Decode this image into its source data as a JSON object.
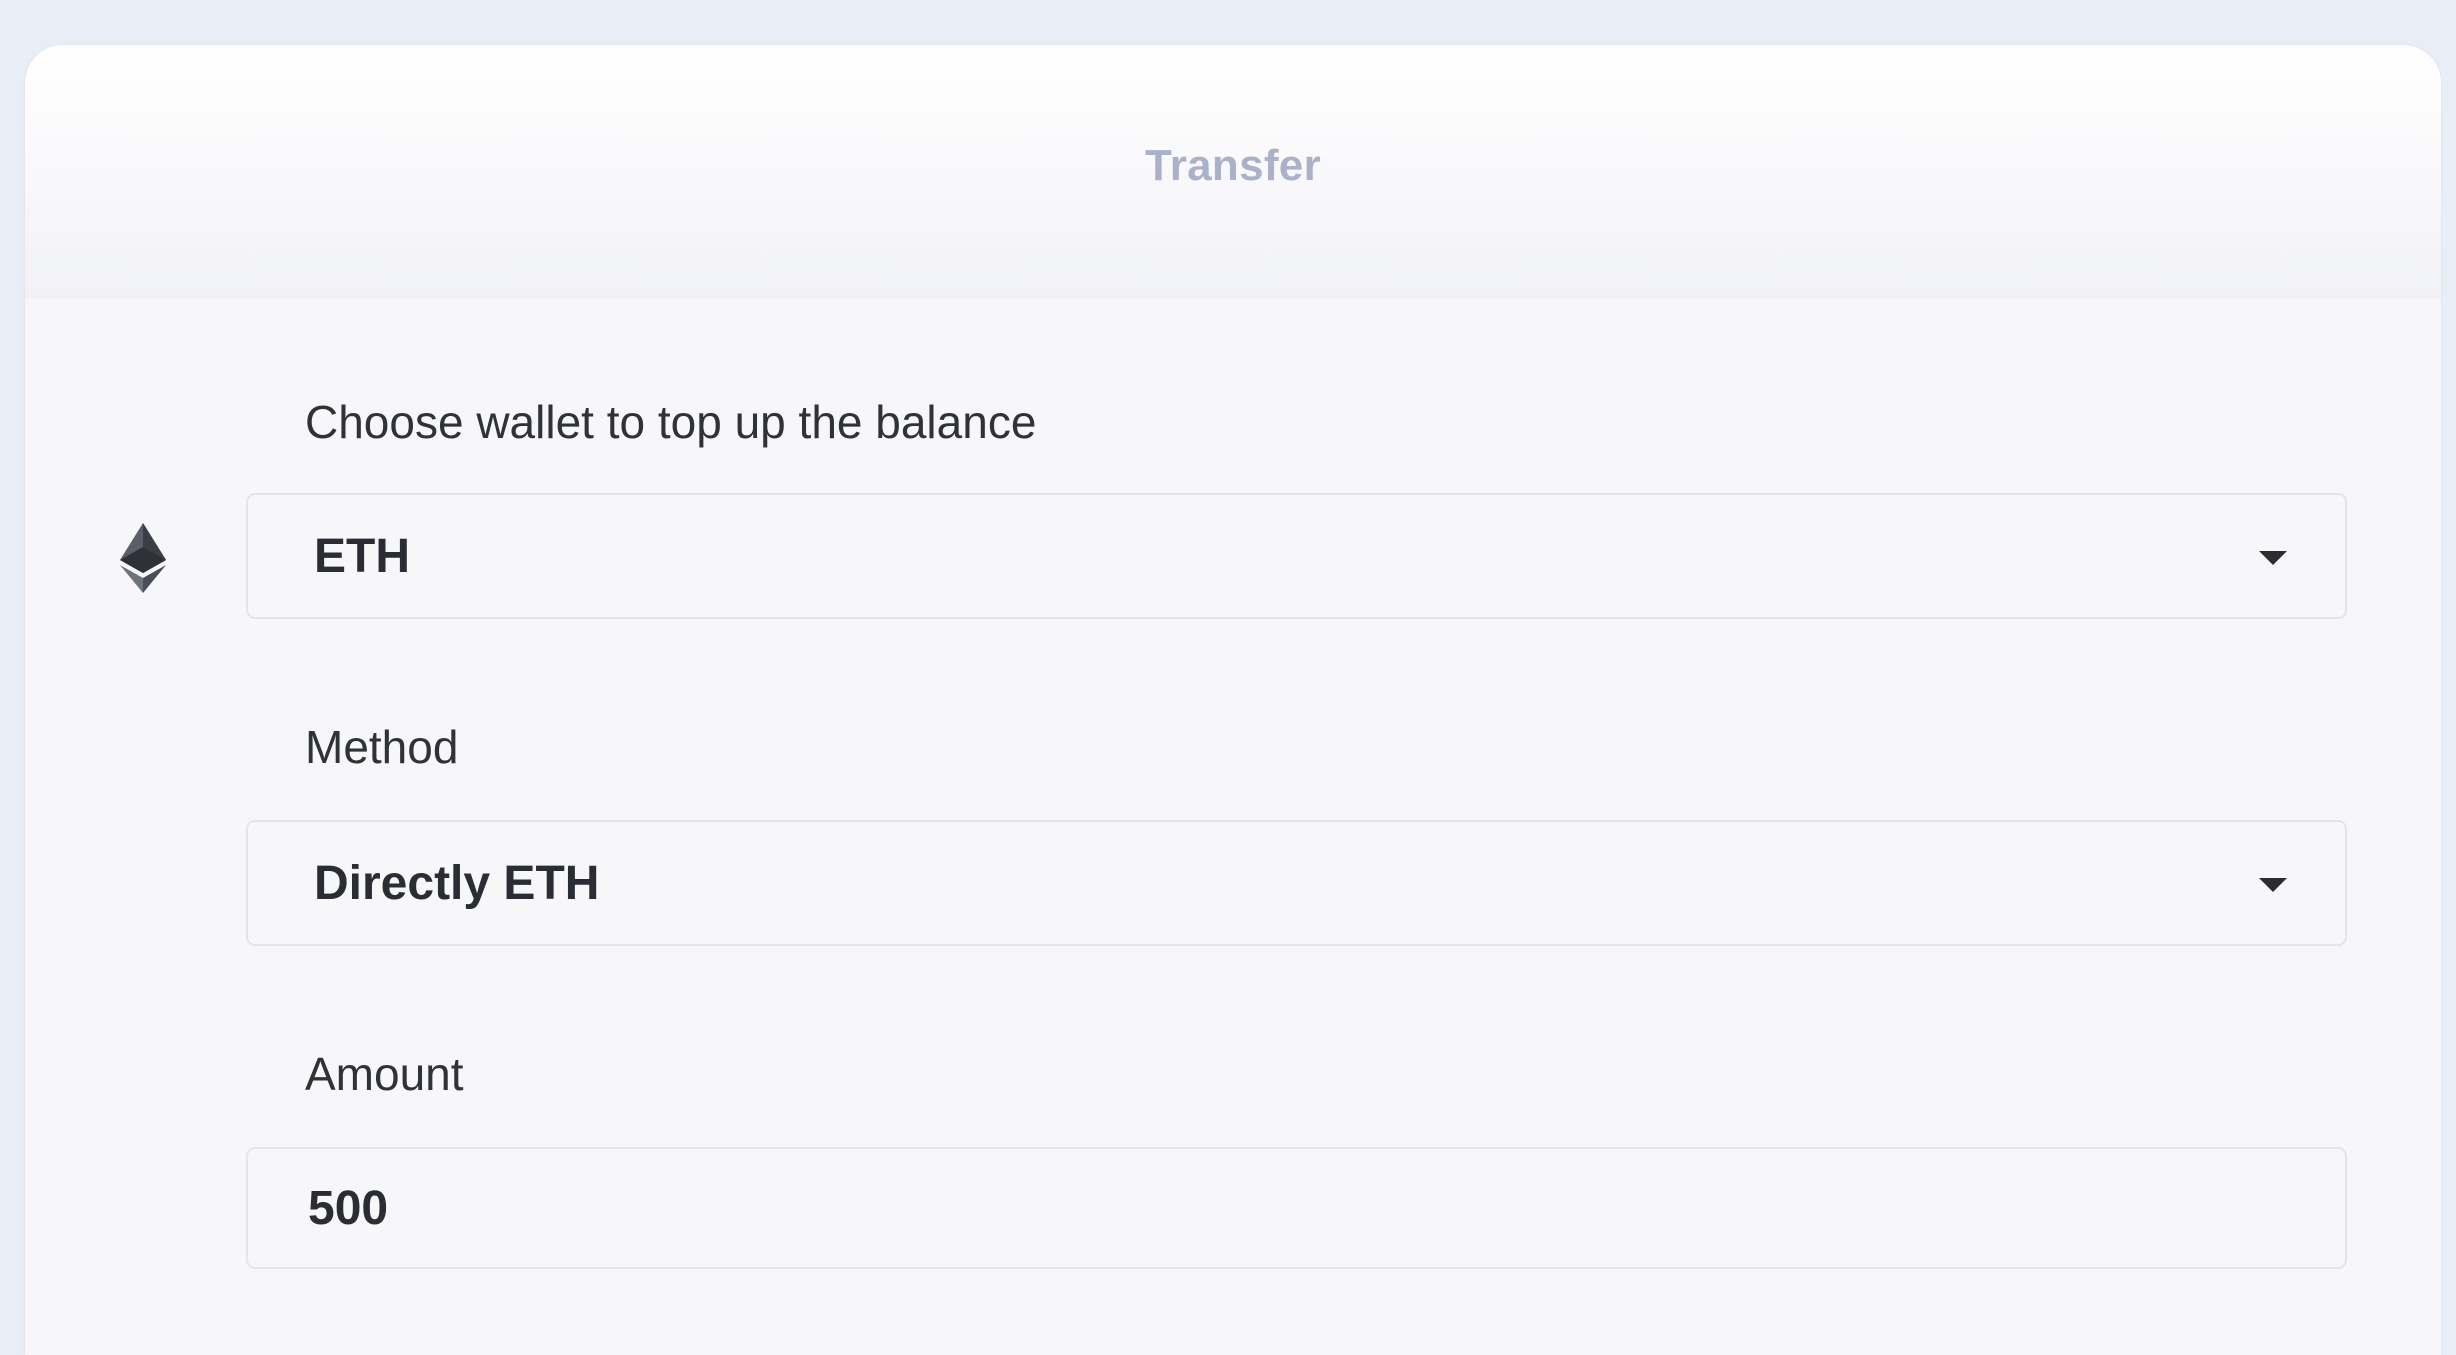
{
  "transfer": {
    "title": "Transfer",
    "wallet": {
      "label": "Choose wallet to top up the balance",
      "selected": "ETH",
      "icon": "ethereum-icon"
    },
    "method": {
      "label": "Method",
      "selected": "Directly ETH"
    },
    "amount": {
      "label": "Amount",
      "value": "500"
    }
  },
  "colors": {
    "page_bg": "#e9edf5",
    "card_bg": "#f7f7fa",
    "title": "#aab2ca",
    "text": "#2a2d33",
    "border": "#e3e5ec"
  }
}
